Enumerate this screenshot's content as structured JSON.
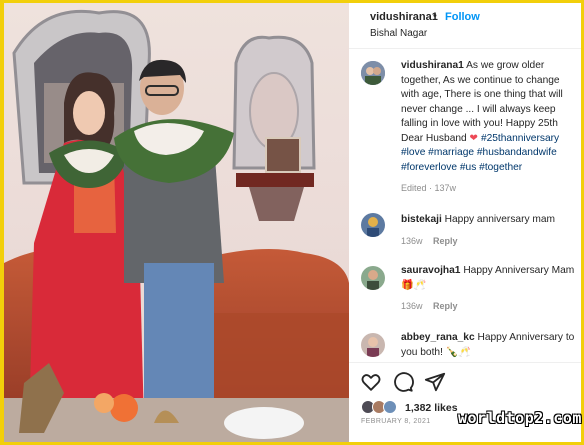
{
  "post": {
    "username": "vidushirana1",
    "separator": "•",
    "follow_label": "Follow",
    "location": "Bishal Nagar"
  },
  "caption": {
    "username": "vidushirana1",
    "text": "As we grow older together, As we continue to change with age, There is one thing that will never change ... I will always keep falling in love with you! Happy 25th Dear Husband",
    "heart": "❤",
    "hashtags": "#25thanniversary #love #marriage #husbandandwife #foreverlove #us #together",
    "edited_label": "Edited",
    "time": "137w"
  },
  "comments": [
    {
      "username": "bistekaji",
      "text": "Happy anniversary mam",
      "time": "136w",
      "reply_label": "Reply"
    },
    {
      "username": "sauravojha1",
      "text": "Happy Anniversary Mam 🎁🥂",
      "time": "136w",
      "reply_label": "Reply"
    },
    {
      "username": "abbey_rana_kc",
      "text": "Happy Anniversary to you both! 🍾🥂"
    }
  ],
  "actions": {
    "like_icon": "heart-outline-icon",
    "comment_icon": "comment-bubble-icon",
    "share_icon": "paper-plane-icon",
    "likes_count": "1,382",
    "likes_label": "likes",
    "date": "FEBRUARY 8, 2021"
  },
  "watermark": "worldtop2.com",
  "colors": {
    "frame": "#f2cf0a",
    "link": "#0095f6",
    "hashtag": "#00376b",
    "muted": "#8e8e8e",
    "heart": "#ed4956"
  }
}
